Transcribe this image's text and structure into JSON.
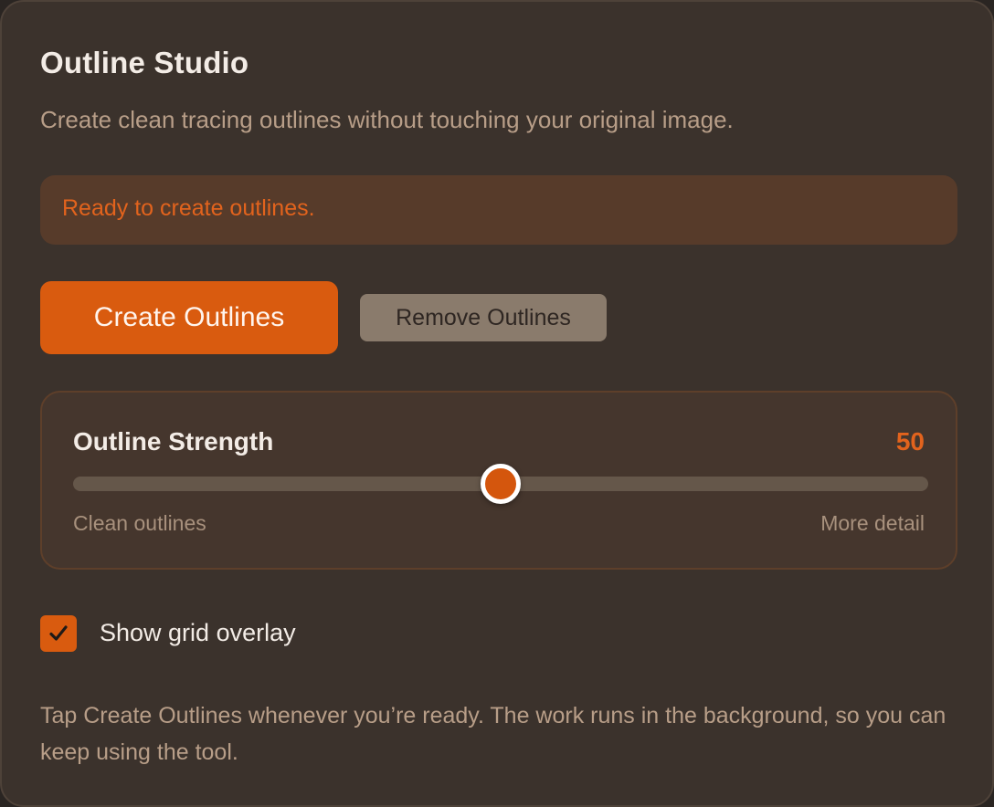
{
  "app": {
    "title": "Outline Studio",
    "subtitle": "Create clean tracing outlines without touching your original image."
  },
  "status": {
    "message": "Ready to create outlines."
  },
  "actions": {
    "create_label": "Create Outlines",
    "remove_label": "Remove Outlines"
  },
  "strength": {
    "label": "Outline Strength",
    "value": "50",
    "min": 0,
    "max": 100,
    "current": 50,
    "hint_left": "Clean outlines",
    "hint_right": "More detail"
  },
  "grid_overlay": {
    "label": "Show grid overlay",
    "checked": true
  },
  "footer": {
    "text": "Tap Create Outlines whenever you’re ready. The work runs in the background, so you can keep using the tool."
  },
  "colors": {
    "accent": "#d95b0f",
    "panel": "#3b322c",
    "status_bg": "#573b2a"
  },
  "icons": {
    "checkbox": "check-icon"
  }
}
